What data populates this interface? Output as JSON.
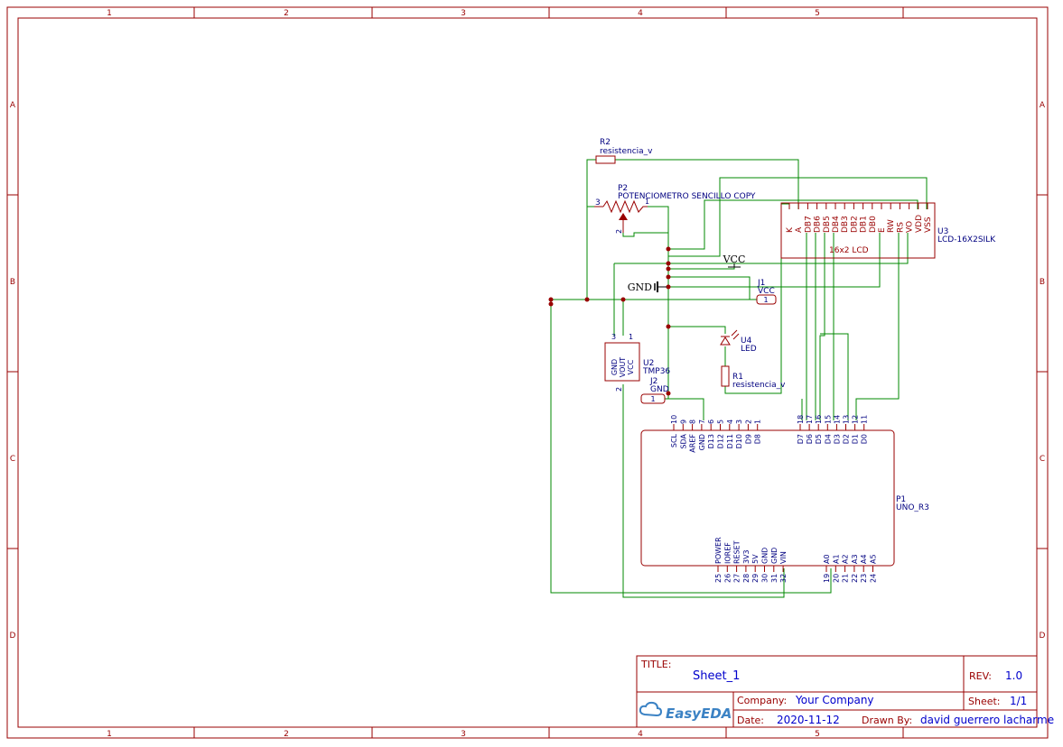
{
  "frame": {
    "columns": [
      "1",
      "2",
      "3",
      "4",
      "5"
    ],
    "rows": [
      "A",
      "B",
      "C",
      "D"
    ]
  },
  "components": {
    "r2": {
      "ref": "R2",
      "value": "resistencia_v"
    },
    "p2": {
      "ref": "P2",
      "value": "POTENCIOMETRO SENCILLO COPY",
      "pin1": "1",
      "pin2": "2",
      "pin3": "3"
    },
    "u3": {
      "ref": "U3",
      "value": "LCD-16X2SILK",
      "label": "16x2 LCD",
      "pins": [
        "K",
        "A",
        "DB7",
        "DB6",
        "DB5",
        "DB4",
        "DB3",
        "DB2",
        "DB1",
        "DB0",
        "E",
        "RW",
        "RS",
        "VO",
        "VDD",
        "VSS"
      ]
    },
    "vcc_flag": "VCC",
    "gnd_flag": "GND",
    "j1": {
      "ref": "J1",
      "value": "VCC",
      "pin": "1"
    },
    "u2": {
      "ref": "U2",
      "value": "TMP36",
      "pins": [
        "GND",
        "VOUT",
        "VCC"
      ],
      "nums": [
        "3",
        "1",
        "2"
      ]
    },
    "j2": {
      "ref": "J2",
      "value": "GND",
      "pin": "1"
    },
    "u4": {
      "ref": "U4",
      "value": "LED"
    },
    "r1": {
      "ref": "R1",
      "value": "resistencia_v"
    },
    "p1": {
      "ref": "P1",
      "value": "UNO_R3",
      "top_left_nums": [
        "10",
        "9",
        "8",
        "7",
        "6",
        "5",
        "4",
        "3",
        "2",
        "1"
      ],
      "top_left_names": [
        "SCL",
        "SDA",
        "AREF",
        "GND",
        "D13",
        "D12",
        "D11",
        "D10",
        "D9",
        "D8"
      ],
      "top_right_nums": [
        "18",
        "17",
        "16",
        "15",
        "14",
        "13",
        "12",
        "11"
      ],
      "top_right_names": [
        "D7",
        "D6",
        "D5",
        "D4",
        "D3",
        "D2",
        "D1",
        "D0"
      ],
      "bottom_left_nums": [
        "25",
        "26",
        "27",
        "28",
        "29",
        "30",
        "31",
        "32"
      ],
      "bottom_left_names": [
        "POWER",
        "IOREF",
        "RESET",
        "3V3",
        "5V",
        "GND",
        "GND",
        "VIN"
      ],
      "bottom_right_nums": [
        "19",
        "20",
        "21",
        "22",
        "23",
        "24"
      ],
      "bottom_right_names": [
        "A0",
        "A1",
        "A2",
        "A3",
        "A4",
        "A5"
      ]
    }
  },
  "title_block": {
    "title_label": "TITLE:",
    "title": "Sheet_1",
    "rev_label": "REV:",
    "rev": "1.0",
    "company_label": "Company:",
    "company": "Your Company",
    "sheet_label": "Sheet:",
    "sheet": "1/1",
    "date_label": "Date:",
    "date": "2020-11-12",
    "drawn_label": "Drawn By:",
    "drawn": "david guerrero lacharme",
    "logo": "EasyEDA"
  },
  "colors": {
    "frame": "#990000",
    "wire": "#008800",
    "text": "#000080",
    "value": "#0000cc"
  }
}
